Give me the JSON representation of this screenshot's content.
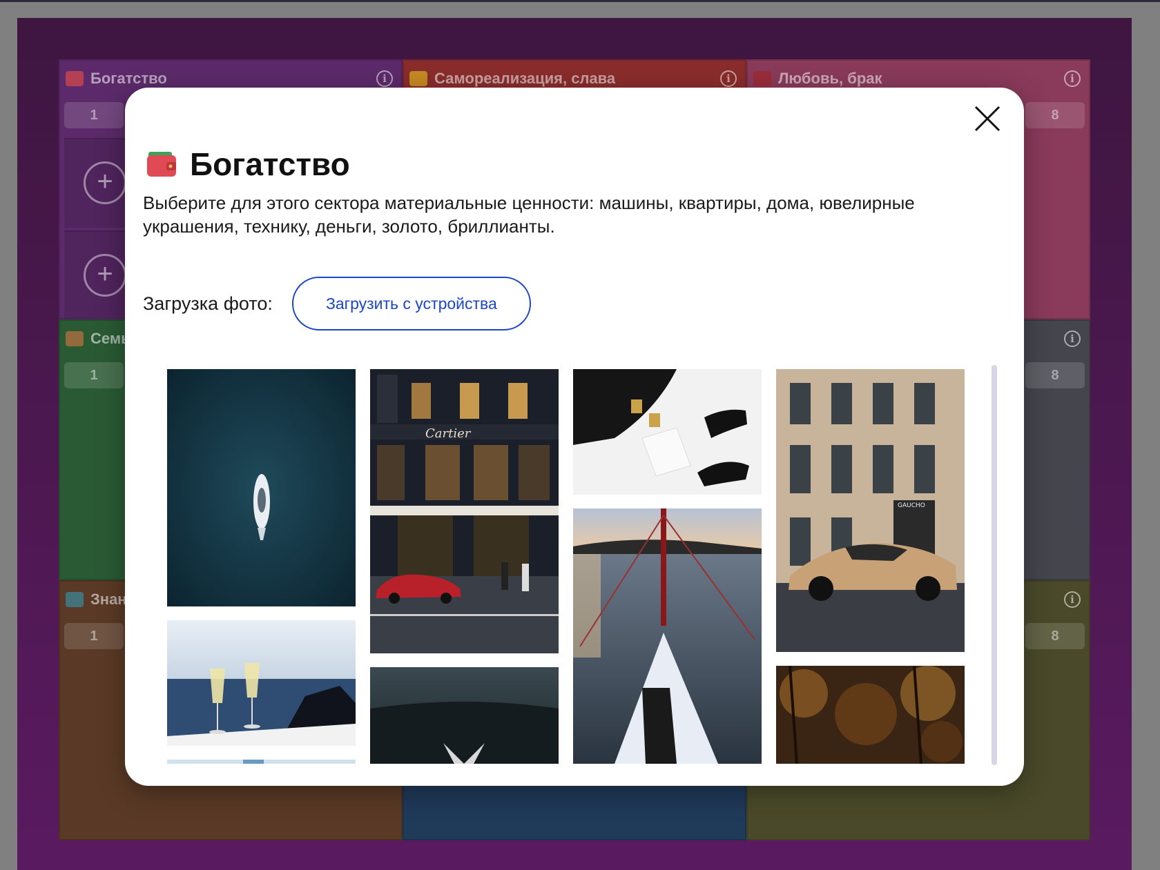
{
  "board": {
    "sectors": [
      {
        "title": "Богатство",
        "num_left": "1",
        "num_right": "",
        "color": "#5c2a6a",
        "emoji_color": "#d94a4a"
      },
      {
        "title": "Самореализация, слава",
        "num_left": "",
        "num_right": "",
        "color": "#8a2c2c",
        "emoji_color": "#e0b020"
      },
      {
        "title": "Любовь, брак",
        "num_left": "",
        "num_right": "8",
        "color": "#8a3a5a",
        "emoji_color": "#a0282c"
      },
      {
        "title": "Семь",
        "num_left": "1",
        "num_right": "",
        "color": "#2a5a34",
        "emoji_color": "#c07040"
      },
      {
        "title": "",
        "num_left": "",
        "num_right": "",
        "color": "#3a2a4a",
        "emoji_color": ""
      },
      {
        "title": "",
        "num_left": "",
        "num_right": "8",
        "color": "#45454e",
        "emoji_color": ""
      },
      {
        "title": "Знан",
        "num_left": "1",
        "num_right": "",
        "color": "#5a3a26",
        "emoji_color": "#3a8aa0"
      },
      {
        "title": "",
        "num_left": "",
        "num_right": "",
        "color": "#203a5a",
        "emoji_color": ""
      },
      {
        "title": "",
        "num_left": "",
        "num_right": "8",
        "color": "#4a4a2a",
        "emoji_color": ""
      }
    ],
    "plus_symbol": "+",
    "info_symbol": "i"
  },
  "modal": {
    "title": "Богатство",
    "title_icon": "wallet-icon",
    "description": "Выберите для этого сектора материальные ценности: машины, квартиры, дома, ювелирные украшения, технику, деньги, золото, бриллианты.",
    "upload_label": "Загрузка фото:",
    "upload_button": "Загрузить с устройства",
    "close_icon": "close-icon",
    "accent_color": "#1a46c7"
  },
  "gallery": {
    "photos": [
      {
        "name": "yacht-aerial-photo",
        "store_sign": ""
      },
      {
        "name": "champagne-glasses-photo",
        "store_sign": ""
      },
      {
        "name": "partial-photo",
        "store_sign": ""
      },
      {
        "name": "cartier-store-photo",
        "store_sign": "Cartier"
      },
      {
        "name": "car-hood-ornament-photo",
        "store_sign": ""
      },
      {
        "name": "jewelry-and-heels-photo",
        "store_sign": ""
      },
      {
        "name": "sailboat-bow-photo",
        "store_sign": ""
      },
      {
        "name": "sports-car-building-photo",
        "store_sign": "GAUCHO"
      },
      {
        "name": "autumn-trees-photo",
        "store_sign": ""
      }
    ]
  }
}
